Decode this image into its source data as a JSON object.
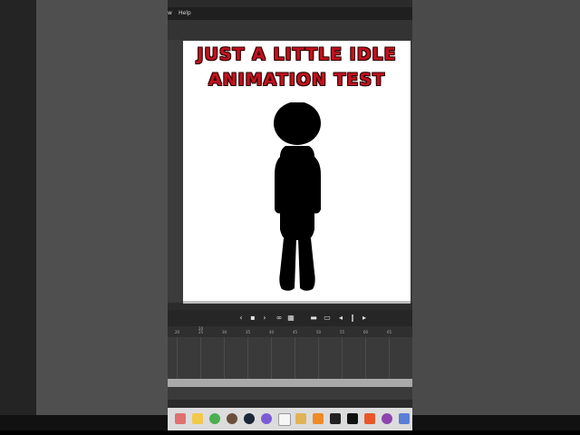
{
  "menu": {
    "view_label": "w",
    "help_label": "Help"
  },
  "canvas": {
    "title_line1": "JUST A LITTLE IDLE",
    "title_line2": "ANIMATION TEST",
    "title_color": "#c1121f"
  },
  "timeline": {
    "ruler_labels": [
      "20",
      "25",
      "30",
      "35",
      "40",
      "45",
      "50",
      "55",
      "60",
      "65",
      "70"
    ],
    "playhead_label": "24",
    "controls": [
      "prev-keyframe-icon",
      "stop-icon",
      "next-keyframe-icon",
      "loop-icon",
      "onion-skin-icon",
      "insert-frame-icon",
      "fit-icon",
      "step-back-icon",
      "pause-icon",
      "play-icon"
    ]
  },
  "taskbar": {
    "icons": [
      "start-icon",
      "explorer-icon",
      "chrome-icon",
      "app-icon",
      "steam-icon",
      "firefox-icon",
      "notepad-icon",
      "folder-icon",
      "animate-icon",
      "roblox-icon",
      "capcut-icon",
      "office-icon",
      "obs-icon",
      "settings-icon"
    ]
  }
}
